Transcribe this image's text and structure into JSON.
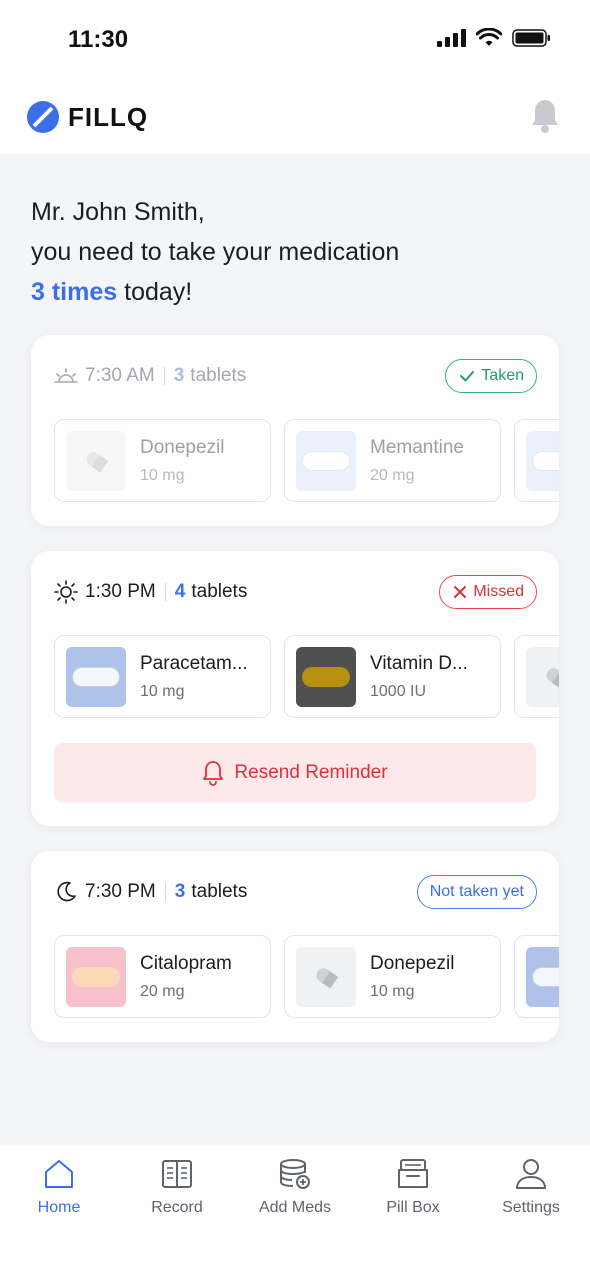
{
  "status": {
    "time": "11:30"
  },
  "header": {
    "brand": "FILLQ"
  },
  "greeting": {
    "line1": "Mr. John Smith,",
    "line2": "you need to take your medication",
    "highlight": "3 times",
    "suffix": " today!"
  },
  "schedules": [
    {
      "time": "7:30 AM",
      "count": "3",
      "unit": "tablets",
      "status": "Taken",
      "meds": [
        {
          "name": "Donepezil",
          "dose": "10 mg"
        },
        {
          "name": "Memantine",
          "dose": "20 mg"
        }
      ]
    },
    {
      "time": "1:30 PM",
      "count": "4",
      "unit": "tablets",
      "status": "Missed",
      "meds": [
        {
          "name": "Paracetam...",
          "dose": "10 mg"
        },
        {
          "name": "Vitamin D...",
          "dose": "1000 IU"
        }
      ],
      "action": "Resend Reminder"
    },
    {
      "time": "7:30 PM",
      "count": "3",
      "unit": "tablets",
      "status": "Not taken yet",
      "meds": [
        {
          "name": "Citalopram",
          "dose": "20 mg"
        },
        {
          "name": "Donepezil",
          "dose": "10 mg"
        }
      ]
    }
  ],
  "nav": [
    {
      "label": "Home",
      "icon": "home-icon"
    },
    {
      "label": "Record",
      "icon": "record-icon"
    },
    {
      "label": "Add Meds",
      "icon": "add-meds-icon"
    },
    {
      "label": "Pill Box",
      "icon": "pill-box-icon"
    },
    {
      "label": "Settings",
      "icon": "settings-icon"
    }
  ],
  "colors": {
    "accent": "#3b6fe8",
    "success": "#1fa06a",
    "danger": "#e0303a"
  }
}
